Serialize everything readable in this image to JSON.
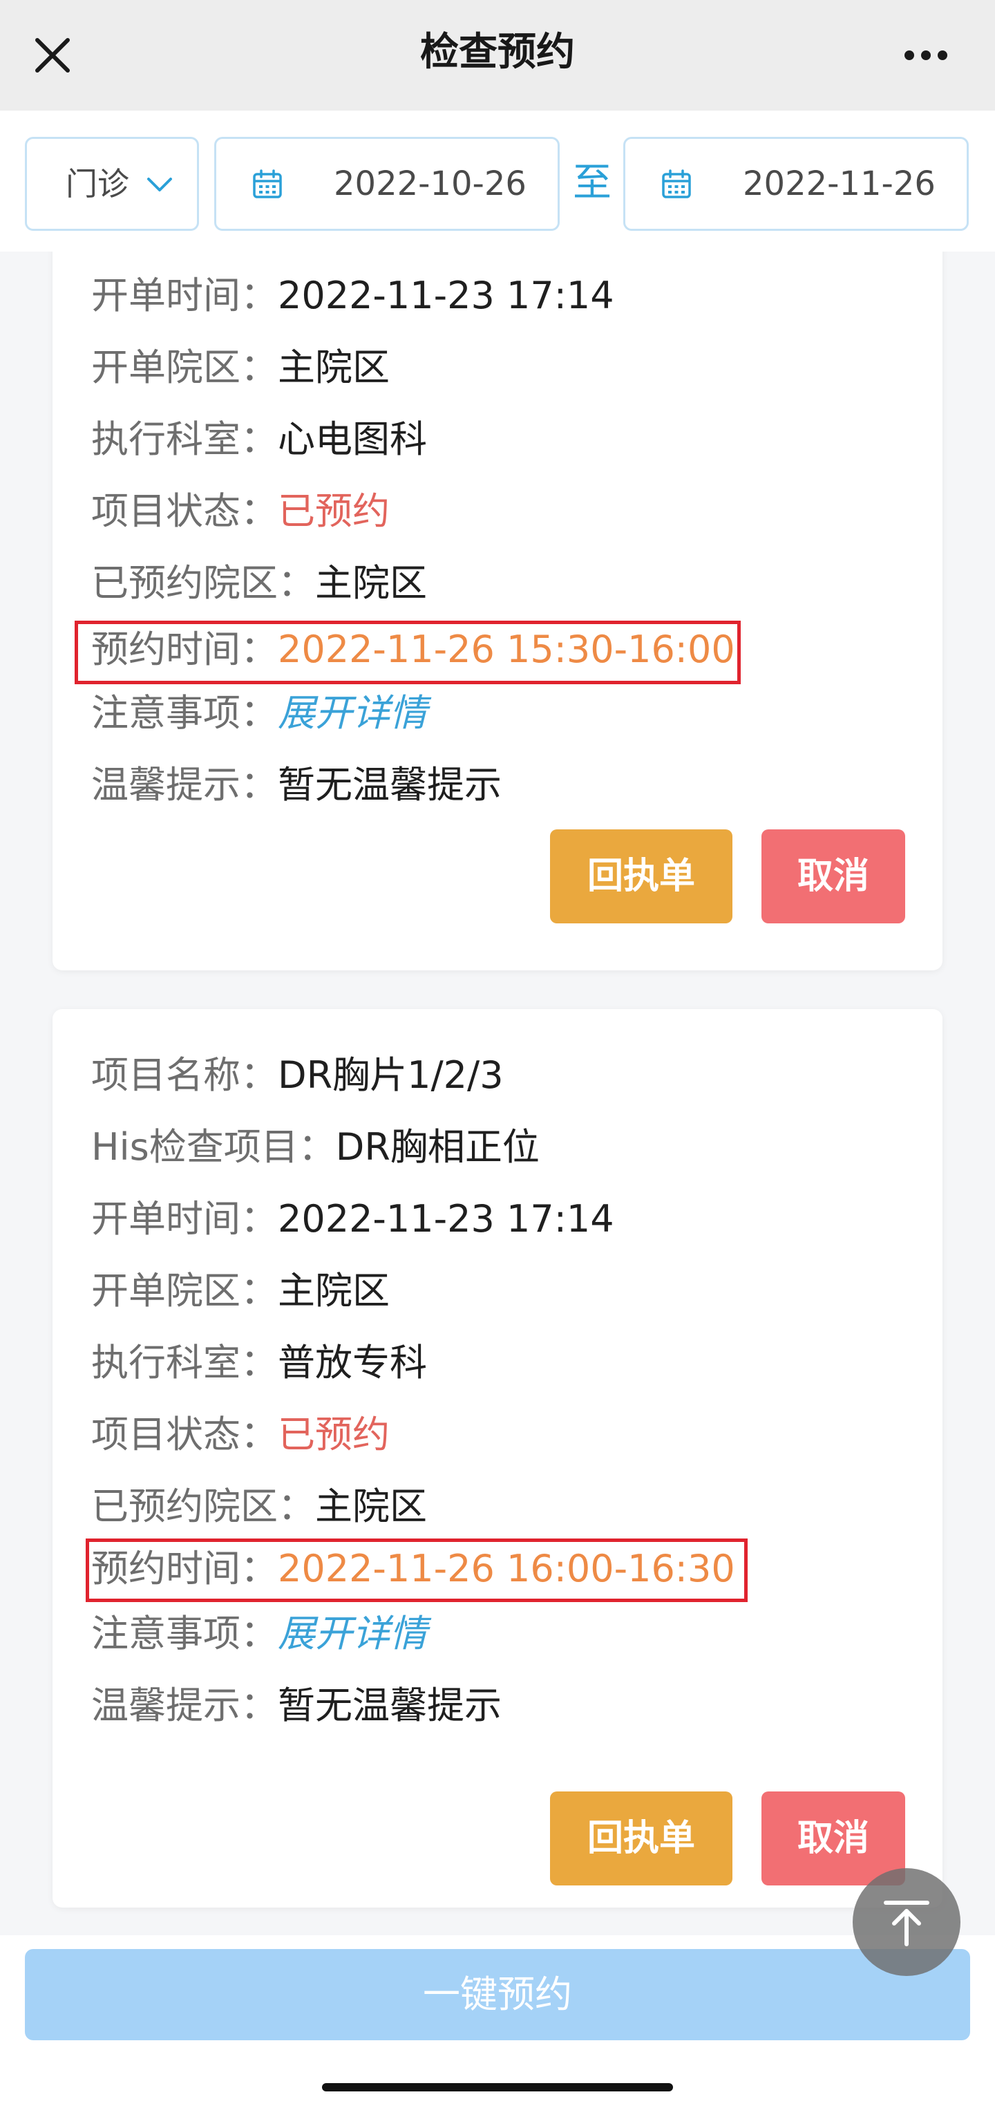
{
  "header": {
    "title": "检查预约"
  },
  "filters": {
    "visit_type": "门诊",
    "start_date": "2022-10-26",
    "to_label": "至",
    "end_date": "2022-11-26"
  },
  "cards": [
    {
      "fields": [
        {
          "label": "开单时间：",
          "value": "2022-11-23 17:14"
        },
        {
          "label": "开单院区：",
          "value": "主院区"
        },
        {
          "label": "执行科室：",
          "value": "心电图科"
        },
        {
          "label": "项目状态：",
          "value": "已预约"
        },
        {
          "label": "已预约院区：",
          "value": "主院区"
        },
        {
          "label": "预约时间：",
          "value": "2022-11-26 15:30-16:00"
        },
        {
          "label": "注意事项：",
          "value": "展开详情"
        },
        {
          "label": "温馨提示：",
          "value": "暂无温馨提示"
        }
      ],
      "buttons": {
        "receipt": "回执单",
        "cancel": "取消"
      }
    },
    {
      "fields": [
        {
          "label": "项目名称：",
          "value": "DR胸片1/2/3"
        },
        {
          "label": "His检查项目：",
          "value": "DR胸相正位"
        },
        {
          "label": "开单时间：",
          "value": "2022-11-23 17:14"
        },
        {
          "label": "开单院区：",
          "value": "主院区"
        },
        {
          "label": "执行科室：",
          "value": "普放专科"
        },
        {
          "label": "项目状态：",
          "value": "已预约"
        },
        {
          "label": "已预约院区：",
          "value": "主院区"
        },
        {
          "label": "预约时间：",
          "value": "2022-11-26 16:00-16:30"
        },
        {
          "label": "注意事项：",
          "value": "展开详情"
        },
        {
          "label": "温馨提示：",
          "value": "暂无温馨提示"
        }
      ],
      "buttons": {
        "receipt": "回执单",
        "cancel": "取消"
      }
    }
  ],
  "footer": {
    "book_all_label": "一键预约"
  },
  "icons": {
    "close": "close-icon",
    "more": "more-icon",
    "dropdown": "chevron-down-icon",
    "calendar": "calendar-icon",
    "back_to_top": "arrow-up-to-top-icon"
  },
  "colors": {
    "accent": "#2aa0d8",
    "status_booked": "#e2645c",
    "appointment_time": "#ee8a45",
    "receipt_button": "#eaa83e",
    "cancel_button": "#f26f73",
    "primary_disabled": "#a5d2f7",
    "highlight_border": "#e0232e"
  }
}
